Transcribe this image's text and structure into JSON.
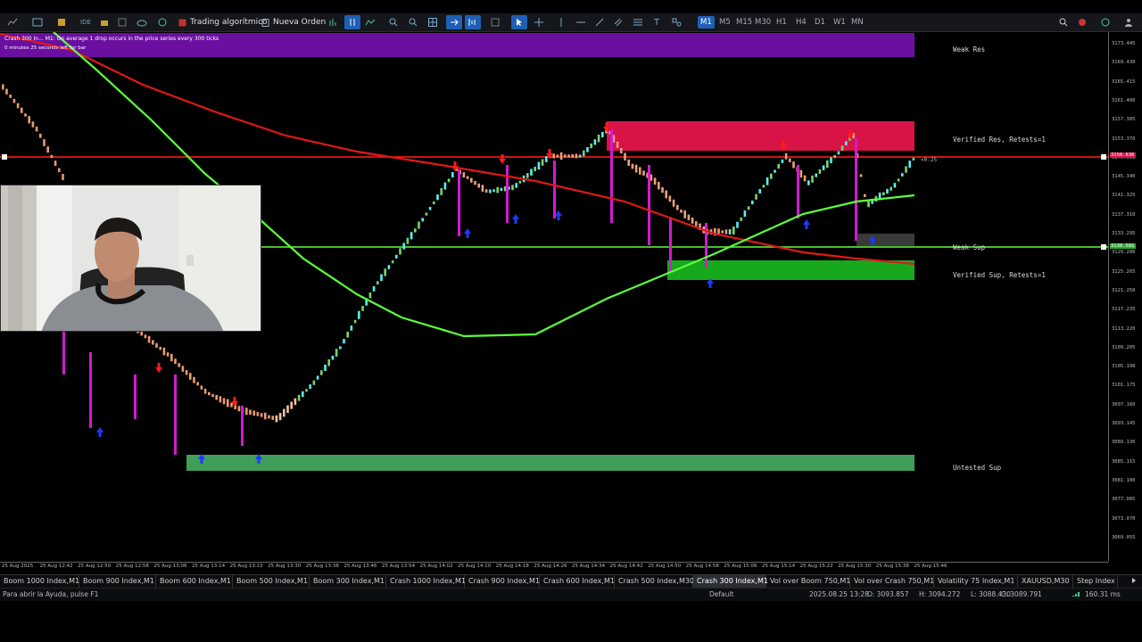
{
  "toolbar": {
    "algo_label": "Trading algorítmico",
    "order_label": "Nueva Orden",
    "timeframes": [
      "M1",
      "M5",
      "M15",
      "M30",
      "H1",
      "H4",
      "D1",
      "W1",
      "MN"
    ],
    "active_timeframe": "M1"
  },
  "chart": {
    "header_line1": "Crash 300 In...  M1:  On average 1 drop occurs in the price series every 300 ticks",
    "header_line2": "0 minutes 25 seconds left for bar",
    "countdown": "<0:25",
    "zones": {
      "weak_res": "Weak Res",
      "verified_res": "Verified Res, Retests=1",
      "weak_sup": "Weak Sup",
      "verified_sup": "Verified Sup, Retests=1",
      "untested_sup": "Untested Sup"
    },
    "price_labels": [
      "3173.445",
      "3169.430",
      "3165.415",
      "3161.400",
      "3157.385",
      "3153.370",
      "3149.355",
      "3145.340",
      "3141.325",
      "3137.310",
      "3133.295",
      "3129.280",
      "3125.265",
      "3121.250",
      "3117.235",
      "3113.220",
      "3109.205",
      "3105.190",
      "3101.175",
      "3097.160",
      "3093.145",
      "3089.130",
      "3085.115",
      "3081.100",
      "3077.085",
      "3073.070",
      "3069.055"
    ],
    "price_tag_current": "3150.636",
    "price_tag_green": "3130.581",
    "time_labels": [
      "25 Aug 2025",
      "25 Aug 12:42",
      "25 Aug 12:50",
      "25 Aug 12:58",
      "25 Aug 13:06",
      "25 Aug 13:14",
      "25 Aug 13:22",
      "25 Aug 13:30",
      "25 Aug 13:38",
      "25 Aug 13:46",
      "25 Aug 13:54",
      "25 Aug 14:02",
      "25 Aug 14:10",
      "25 Aug 14:18",
      "25 Aug 14:26",
      "25 Aug 14:34",
      "25 Aug 14:42",
      "25 Aug 14:50",
      "25 Aug 14:58",
      "25 Aug 15:06",
      "25 Aug 15:14",
      "25 Aug 15:22",
      "25 Aug 15:30",
      "25 Aug 15:38",
      "25 Aug 15:46"
    ]
  },
  "tabs": [
    {
      "label": "Boom 1000 Index,M1",
      "active": false
    },
    {
      "label": "Boom 900 Index,M1",
      "active": false
    },
    {
      "label": "Boom 600 Index,M1",
      "active": false
    },
    {
      "label": "Boom 500 Index,M1",
      "active": false
    },
    {
      "label": "Boom 300 Index,M1",
      "active": false
    },
    {
      "label": "Crash 1000 Index,M1",
      "active": false
    },
    {
      "label": "Crash 900 Index,M1",
      "active": false
    },
    {
      "label": "Crash 600 Index,M1",
      "active": false
    },
    {
      "label": "Crash 500 Index,M30",
      "active": false
    },
    {
      "label": "Crash 300 Index,M1",
      "active": true
    },
    {
      "label": "Vol over Boom 750,M1",
      "active": false
    },
    {
      "label": "Vol over Crash 750,M1",
      "active": false
    },
    {
      "label": "Volatility 75 Index,M1",
      "active": false
    },
    {
      "label": "XAUUSD,M30",
      "active": false
    },
    {
      "label": "Step Index",
      "active": false
    }
  ],
  "status": {
    "help": "Para abrir la Ayuda, pulse F1",
    "profile": "Default",
    "datetime": "2025.08.25 13:28",
    "open": "O: 3093.857",
    "high": "H: 3094.272",
    "low": "L: 3088.430",
    "close": "C: 3089.791",
    "ping": "160.31 ms"
  },
  "colors": {
    "fast_ma": "#5cff3c",
    "slow_ma": "#e01818",
    "res_zone": "#d81346",
    "sup_zone_verified": "#18a81e",
    "sup_zone_untested": "#3f9e57",
    "header_band": "#6a0fa0"
  }
}
